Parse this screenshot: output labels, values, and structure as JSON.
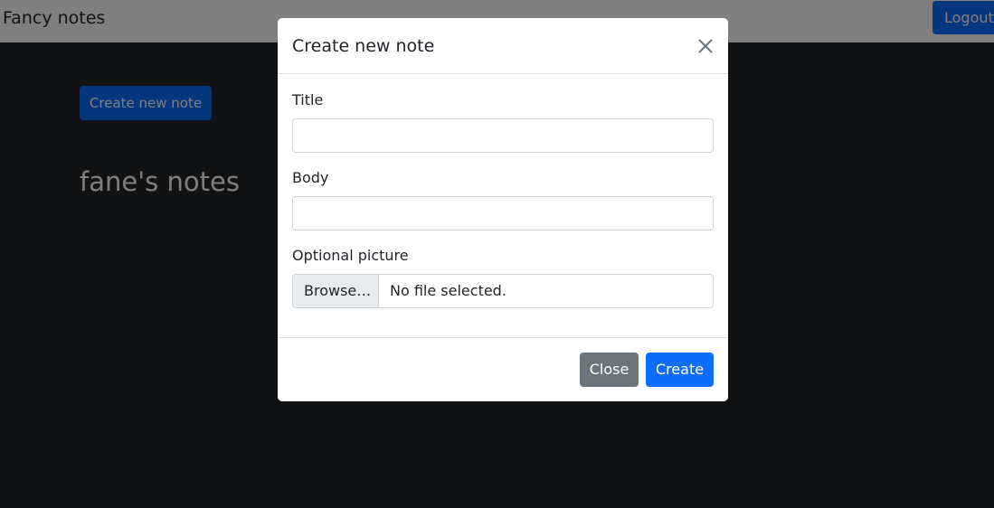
{
  "navbar": {
    "brand": "Fancy notes",
    "logout_label": "Logout"
  },
  "main": {
    "create_button_label": "Create new note",
    "notes_heading": "fane's notes"
  },
  "modal": {
    "title": "Create new note",
    "fields": {
      "title_label": "Title",
      "title_value": "",
      "body_label": "Body",
      "body_value": "",
      "picture_label": "Optional picture",
      "browse_label": "Browse…",
      "file_status": "No file selected."
    },
    "footer": {
      "close_label": "Close",
      "create_label": "Create"
    }
  },
  "colors": {
    "primary": "#0d6efd",
    "secondary": "#6c757d",
    "background": "#212529",
    "backdrop": "rgba(0,0,0,0.5)"
  },
  "icons": {
    "modal_close": "close-icon"
  }
}
